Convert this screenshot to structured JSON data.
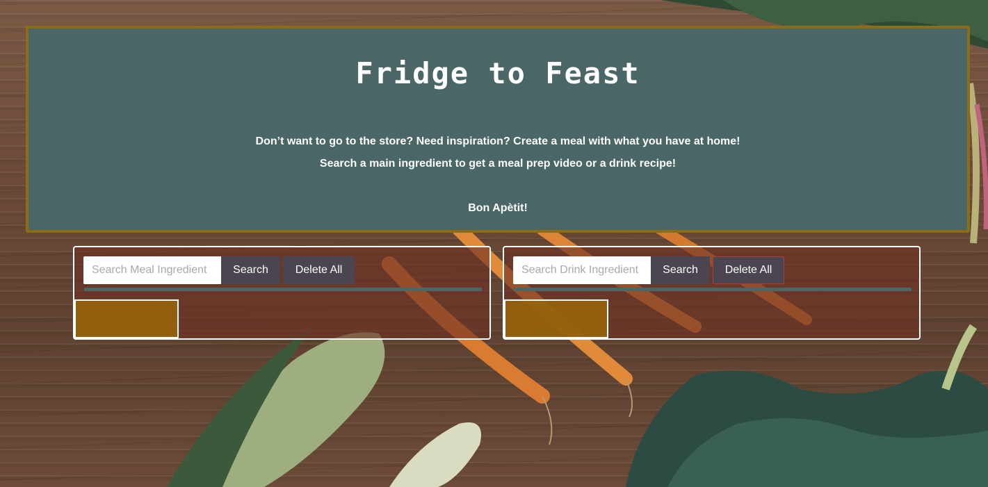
{
  "header": {
    "title": "Fridge to Feast",
    "tagline_1": "Don’t want to go to the store? Need inspiration? Create a meal with what you have at home!",
    "tagline_2": "Search a main ingredient to get a meal prep video or a drink recipe!",
    "tagline_3": "Bon Apètit!"
  },
  "meal_panel": {
    "placeholder": "Search Meal Ingredient",
    "value": "",
    "search_label": "Search",
    "delete_label": "Delete All"
  },
  "drink_panel": {
    "placeholder": "Search Drink Ingredient",
    "value": "",
    "search_label": "Search",
    "delete_label": "Delete All"
  },
  "colors": {
    "header_bg": "#4a6666",
    "header_border": "#8a6d16",
    "button_bg": "#4a4550",
    "result_box": "#96640a"
  },
  "icons": {
    "background": "wood-table-with-vegetables-image"
  }
}
